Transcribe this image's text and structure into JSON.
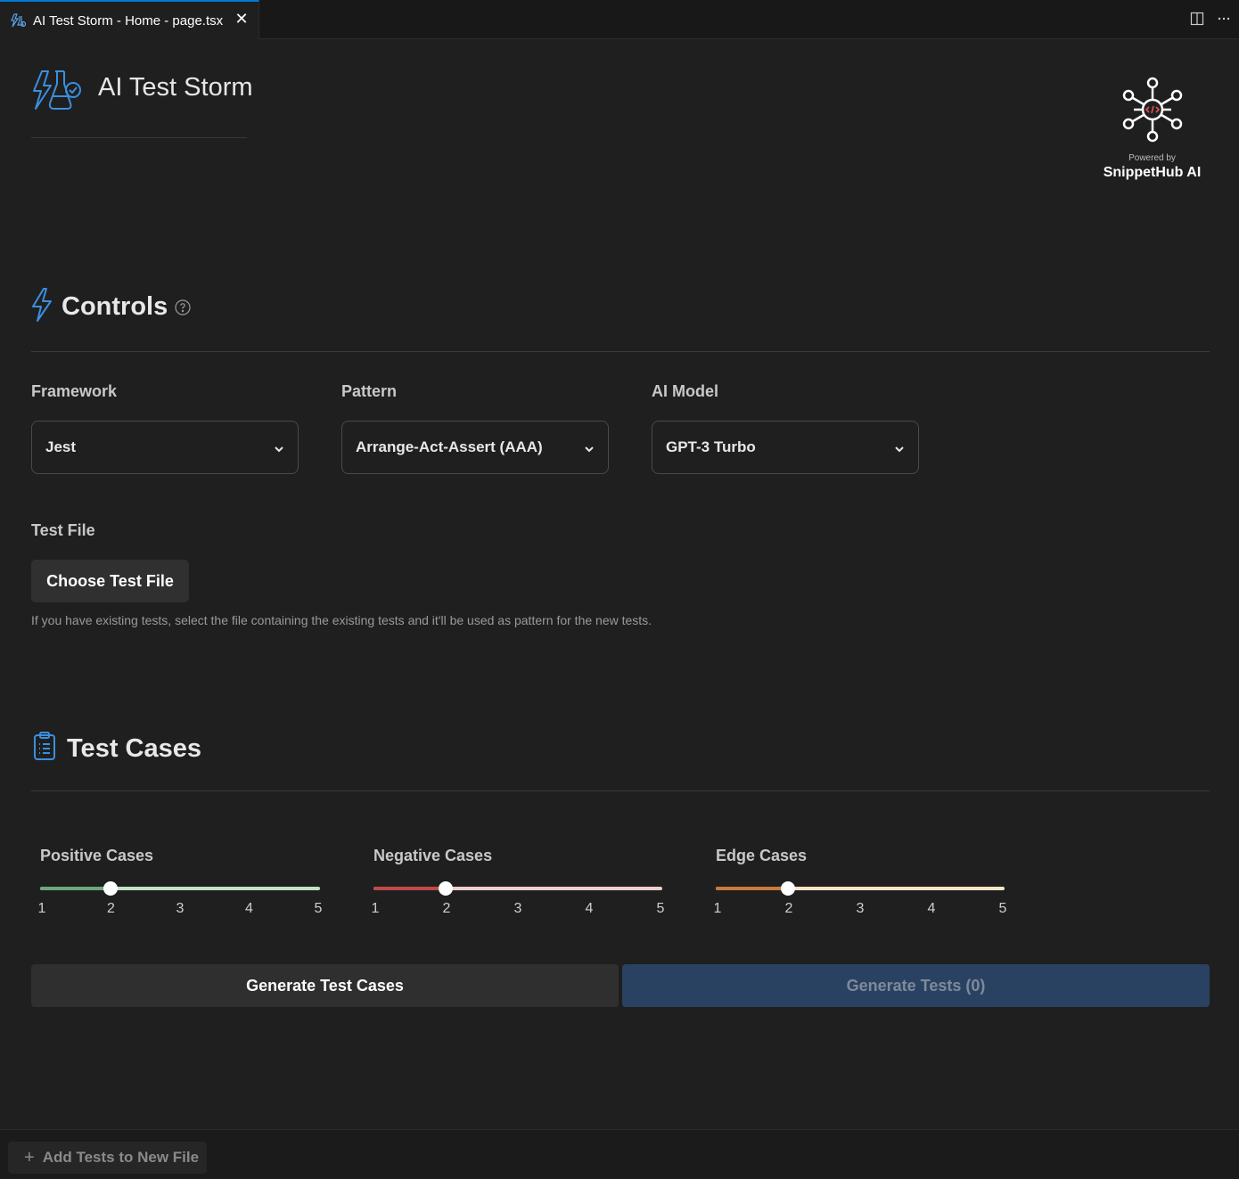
{
  "tab": {
    "title": "AI Test Storm - Home - page.tsx",
    "close": "✕"
  },
  "header": {
    "title": "AI Test Storm"
  },
  "brand": {
    "powered_by": "Powered by",
    "name": "SnippetHub AI"
  },
  "controls": {
    "title": "Controls",
    "framework": {
      "label": "Framework",
      "value": "Jest"
    },
    "pattern": {
      "label": "Pattern",
      "value": "Arrange-Act-Assert (AAA)"
    },
    "model": {
      "label": "AI Model",
      "value": "GPT-3 Turbo"
    },
    "test_file": {
      "label": "Test File",
      "button": "Choose Test File",
      "hint": "If you have existing tests, select the file containing the existing tests and it'll be used as pattern for the new tests."
    }
  },
  "test_cases": {
    "title": "Test Cases",
    "sliders": [
      {
        "label": "Positive Cases",
        "value": 2,
        "min": 1,
        "max": 5,
        "fill_color": "#6aa77a",
        "track_color": "#bfe3c6"
      },
      {
        "label": "Negative Cases",
        "value": 2,
        "min": 1,
        "max": 5,
        "fill_color": "#c04a4a",
        "track_color": "#f2cccc"
      },
      {
        "label": "Edge Cases",
        "value": 2,
        "min": 1,
        "max": 5,
        "fill_color": "#c77a3a",
        "track_color": "#f6e6c4"
      }
    ],
    "ticks": [
      "1",
      "2",
      "3",
      "4",
      "5"
    ]
  },
  "actions": {
    "generate_cases": "Generate Test Cases",
    "generate_tests": "Generate Tests (0)"
  },
  "footer": {
    "add_label": "Add Tests to New File",
    "add_plus": "+"
  },
  "colors": {
    "accent": "#3794ff",
    "primary_disabled": "#2a4262"
  }
}
